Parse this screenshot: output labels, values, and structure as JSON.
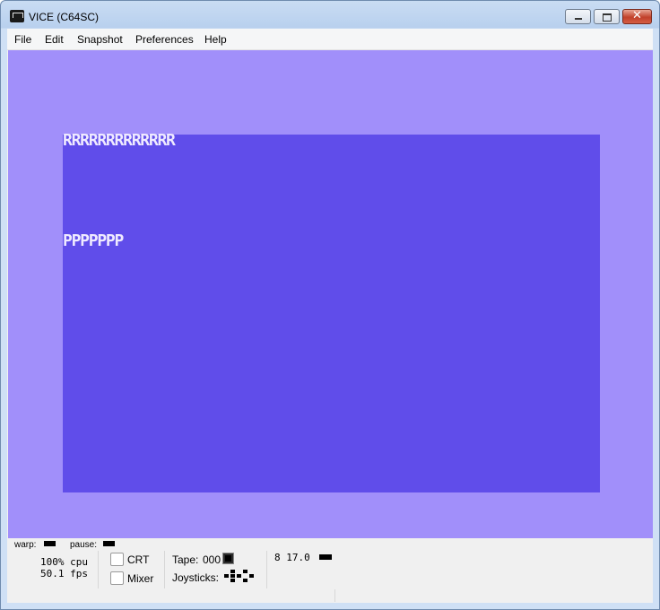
{
  "window": {
    "title": "VICE (C64SC)",
    "controls": {
      "minimize_icon": "minimize-icon",
      "maximize_icon": "maximize-icon",
      "close_glyph": "✕"
    }
  },
  "menubar": {
    "items": [
      {
        "label": "File"
      },
      {
        "label": "Edit"
      },
      {
        "label": "Snapshot"
      },
      {
        "label": "Preferences"
      },
      {
        "label": "Help"
      }
    ]
  },
  "c64_display": {
    "border_color": "#a18ffa",
    "screen_color": "#604dea",
    "text_color": "#efeaff",
    "lines": [
      {
        "text": "RRRRRRRRRRRRR"
      },
      {
        "text": "PPPPPPP"
      }
    ]
  },
  "statusbar": {
    "warp_label": "warp:",
    "pause_label": "pause:",
    "cpu_text": "100% cpu",
    "fps_text": "50.1 fps",
    "crt_label": "CRT",
    "mixer_label": "Mixer",
    "tape_label": "Tape:",
    "tape_counter": "000",
    "joysticks_label": "Joysticks:",
    "drive_text": "8 17.0"
  }
}
